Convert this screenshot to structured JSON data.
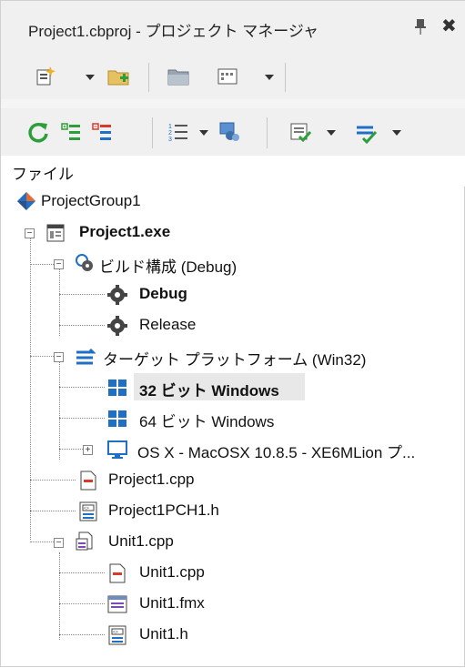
{
  "window": {
    "title": "Project1.cbproj - プロジェクト マネージャ",
    "pin_icon": "pin-icon",
    "close_icon": "close-icon"
  },
  "toolbar1": {
    "buttons": [
      "new-item-icon",
      "add-folder-icon",
      "folder-icon",
      "layout-icon"
    ]
  },
  "toolbar2": {
    "buttons": [
      "sync-icon",
      "expand-icon",
      "collapse-icon",
      "build-order-icon",
      "devices-icon",
      "build-icon",
      "multi-build-icon"
    ]
  },
  "header": {
    "label": "ファイル"
  },
  "tree": {
    "project_group": "ProjectGroup1",
    "project": "Project1.exe",
    "build_config": "ビルド構成 (Debug)",
    "config_debug": "Debug",
    "config_release": "Release",
    "target_platforms": "ターゲット プラットフォーム (Win32)",
    "platform_32": "32 ビット Windows",
    "platform_64": "64 ビット Windows",
    "platform_osx": "OS X - MacOSX 10.8.5 - XE6MLion プ...",
    "file_project_cpp": "Project1.cpp",
    "file_pch": "Project1PCH1.h",
    "file_unit": "Unit1.cpp",
    "unit_cpp": "Unit1.cpp",
    "unit_fmx": "Unit1.fmx",
    "unit_h": "Unit1.h"
  },
  "colors": {
    "accent_blue": "#1f6fc4",
    "green": "#2e9e3a",
    "red": "#d83a2a",
    "gear": "#444444",
    "selection": "#e8e8e8"
  }
}
